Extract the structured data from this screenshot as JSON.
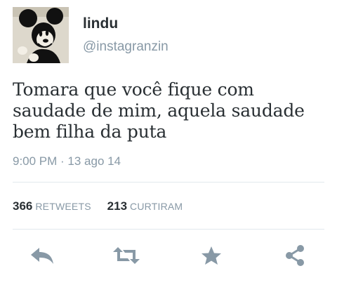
{
  "user": {
    "display_name": "lindu",
    "username": "@instagranzin",
    "avatar_icon": "mickey-mouse-avatar"
  },
  "tweet": {
    "lines": [
      "Tomara que você fique com",
      "saudade de mim, aquela saudade",
      "bem filha da puta"
    ],
    "timestamp": "9:00 PM · 13 ago 14"
  },
  "stats": {
    "retweets_count": "366",
    "retweets_label": "RETWEETS",
    "likes_count": "213",
    "likes_label": "CURTIRAM"
  },
  "actions": {
    "reply_icon": "reply-icon",
    "retweet_icon": "retweet-icon",
    "favorite_icon": "star-icon",
    "share_icon": "share-icon"
  },
  "colors": {
    "icon_gray": "#8899a6",
    "text_dark": "#292f33",
    "divider": "#e1e8ed"
  }
}
